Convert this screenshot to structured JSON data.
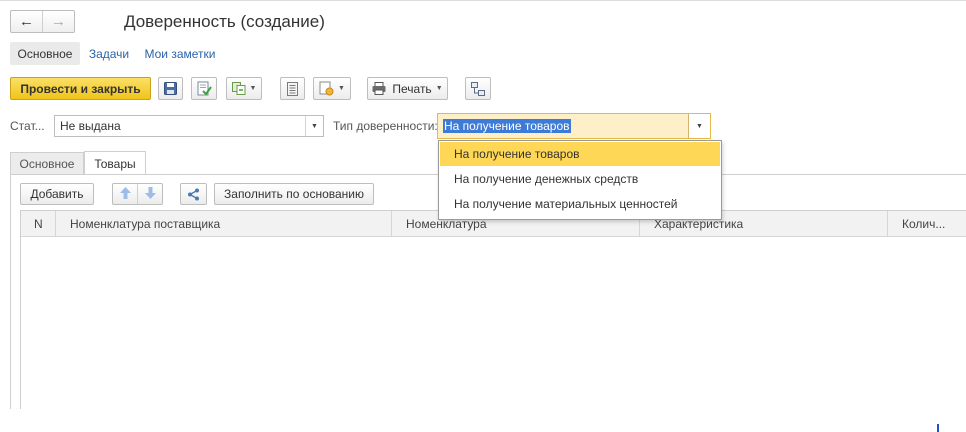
{
  "window": {
    "title": "Доверенность (создание)"
  },
  "nav": {
    "back_glyph": "←",
    "forward_glyph": "→"
  },
  "top_tabs": [
    {
      "label": "Основное"
    },
    {
      "label": "Задачи"
    },
    {
      "label": "Мои заметки"
    }
  ],
  "toolbar": {
    "post_close_label": "Провести и закрыть",
    "print_label": "Печать",
    "icons": [
      "save-icon",
      "post-icon",
      "create-based-on-icon",
      "report-icon",
      "attachments-icon",
      "printer-icon",
      "structure-icon"
    ]
  },
  "form": {
    "status_label": "Стат...",
    "status_value": "Не выдана",
    "type_label": "Тип доверенности:",
    "type_value": "На получение товаров"
  },
  "dropdown": {
    "options": [
      "На получение товаров",
      "На получение денежных средств",
      "На получение материальных ценностей"
    ],
    "selected_index": 0
  },
  "inner_tabs": [
    {
      "label": "Основное"
    },
    {
      "label": "Товары"
    }
  ],
  "table_toolbar": {
    "add_label": "Добавить",
    "fill_label": "Заполнить по основанию"
  },
  "table": {
    "columns": [
      "N",
      "Номенклатура поставщика",
      "Номенклатура",
      "Характеристика",
      "Колич..."
    ],
    "rows": []
  },
  "colors": {
    "accent_yellow": "#f7d23b",
    "dropdown_selected": "#fdd755",
    "link_blue": "#2b63a8",
    "selection_blue": "#3d7bd6"
  }
}
